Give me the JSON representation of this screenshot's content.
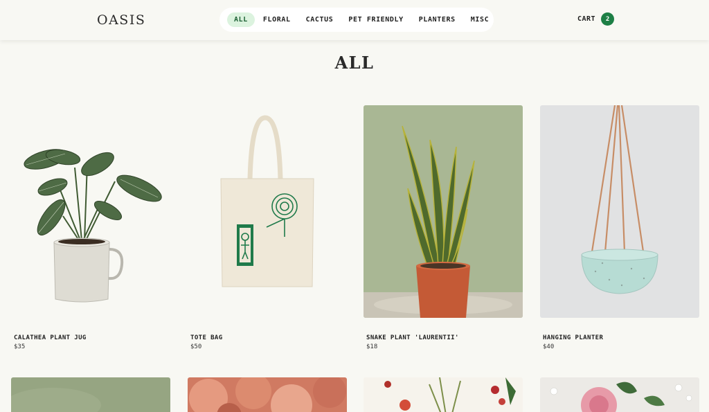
{
  "header": {
    "logo": "OASIS",
    "nav": [
      {
        "label": "ALL",
        "active": true
      },
      {
        "label": "FLORAL"
      },
      {
        "label": "CACTUS"
      },
      {
        "label": "PET FRIENDLY"
      },
      {
        "label": "PLANTERS"
      },
      {
        "label": "MISC"
      }
    ],
    "cart_label": "CART",
    "cart_count": "2"
  },
  "page": {
    "title": "ALL"
  },
  "products": [
    {
      "name": "CALATHEA PLANT JUG",
      "price": "$35"
    },
    {
      "name": "TOTE BAG",
      "price": "$50"
    },
    {
      "name": "SNAKE PLANT 'LAURENTII'",
      "price": "$18"
    },
    {
      "name": "HANGING PLANTER",
      "price": "$40"
    }
  ],
  "colors": {
    "background": "#f8f8f3",
    "accent": "#1d7f45",
    "active_tab": "#dcf3df"
  }
}
